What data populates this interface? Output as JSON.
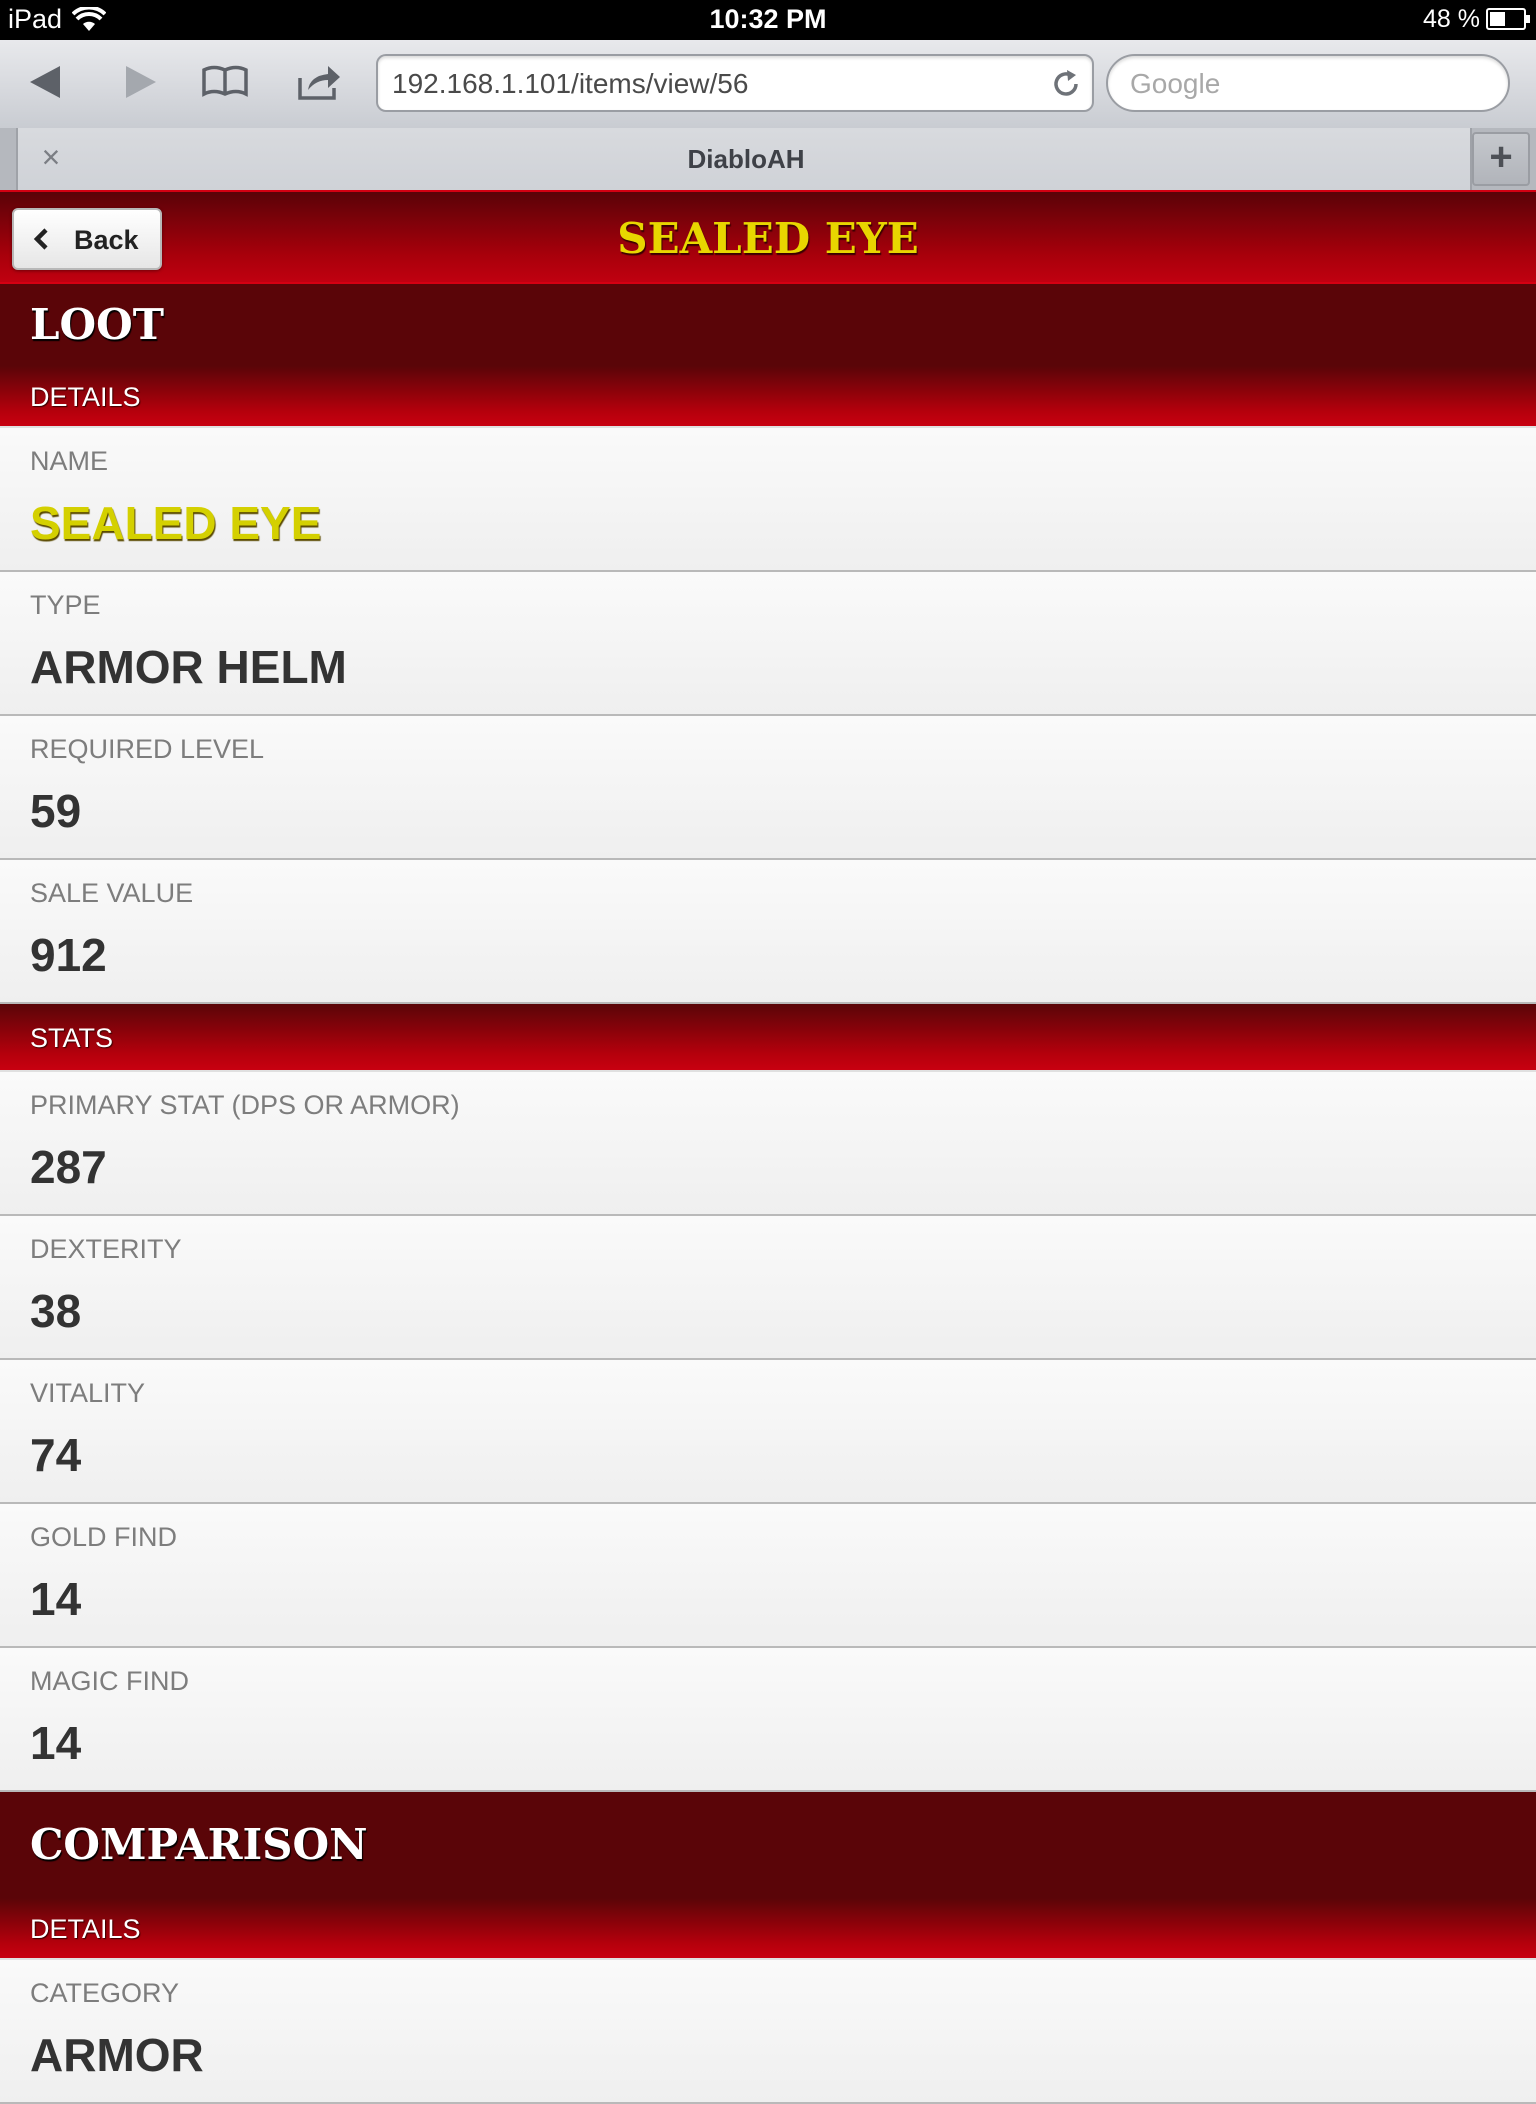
{
  "status_bar": {
    "device": "iPad",
    "time": "10:32 PM",
    "battery": "48 %",
    "battery_level": 0.48
  },
  "browser": {
    "url": "192.168.1.101/items/view/56",
    "search_placeholder": "Google",
    "tab_title": "DiabloAH",
    "tab_close": "×",
    "tab_add": "+"
  },
  "header": {
    "back_label": "Back",
    "title": "SEALED EYE",
    "title_color": "#e8d600",
    "bar_color": "#a8000b"
  },
  "loot": {
    "title": "LOOT",
    "details_label": "DETAILS",
    "fields": [
      {
        "label": "NAME",
        "value": "SEALED EYE"
      },
      {
        "label": "TYPE",
        "value": "ARMOR HELM"
      },
      {
        "label": "REQUIRED LEVEL",
        "value": "59"
      },
      {
        "label": "SALE VALUE",
        "value": "912"
      }
    ],
    "stats_label": "STATS",
    "stats": [
      {
        "label": "PRIMARY STAT (DPS OR ARMOR)",
        "value": "287"
      },
      {
        "label": "DEXTERITY",
        "value": "38"
      },
      {
        "label": "VITALITY",
        "value": "74"
      },
      {
        "label": "GOLD FIND",
        "value": "14"
      },
      {
        "label": "MAGIC FIND",
        "value": "14"
      }
    ]
  },
  "comparison": {
    "title": "COMPARISON",
    "details_label": "DETAILS",
    "fields": [
      {
        "label": "CATEGORY",
        "value": "ARMOR"
      }
    ]
  }
}
